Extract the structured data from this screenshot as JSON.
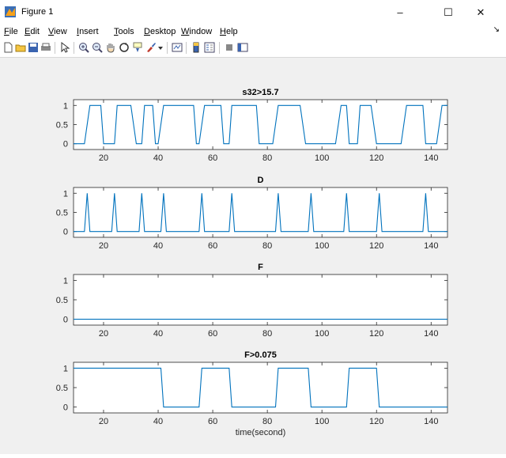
{
  "window": {
    "title": "Figure 1"
  },
  "window_controls": {
    "minimize": "–",
    "maximize": "☐",
    "close": "✕"
  },
  "menu": {
    "items": [
      {
        "label": "File",
        "key": "F",
        "rest": "ile"
      },
      {
        "label": "Edit",
        "key": "E",
        "rest": "dit"
      },
      {
        "label": "View",
        "key": "V",
        "rest": "iew"
      },
      {
        "label": "Insert",
        "key": "I",
        "rest": "nsert"
      },
      {
        "label": "Tools",
        "key": "T",
        "rest": "ools"
      },
      {
        "label": "Desktop",
        "key": "D",
        "rest": "esktop"
      },
      {
        "label": "Window",
        "key": "W",
        "rest": "indow"
      },
      {
        "label": "Help",
        "key": "H",
        "rest": "elp"
      }
    ]
  },
  "toolbar": {
    "icons": [
      "new-file-icon",
      "open-folder-icon",
      "save-icon",
      "print-icon",
      "pointer-icon",
      "zoom-in-icon",
      "zoom-out-icon",
      "pan-hand-icon",
      "rotate-3d-icon",
      "data-cursor-icon",
      "brush-icon",
      "dropdown-arrow-icon",
      "link-plot-icon",
      "colorbar-icon",
      "legend-icon",
      "hide-plot-tools-icon",
      "show-plot-tools-icon"
    ]
  },
  "colors": {
    "line": "#0072bd",
    "axes_bg": "#ffffff",
    "figure_bg": "#f0f0f0",
    "axis": "#262626"
  },
  "chart_data": [
    {
      "type": "line",
      "title": "s32>15.7",
      "xlabel": "",
      "ylabel": "",
      "xlim": [
        9,
        146
      ],
      "ylim": [
        -0.15,
        1.15
      ],
      "xticks": [
        20,
        40,
        60,
        80,
        100,
        120,
        140
      ],
      "yticks": [
        0,
        0.5,
        1
      ],
      "ytick_labels": [
        "0",
        "0.5",
        "1"
      ],
      "x": [
        9,
        13,
        15,
        19,
        20,
        24,
        25,
        30,
        32,
        34,
        35,
        38,
        39,
        40,
        42,
        53,
        54,
        55,
        57,
        63,
        64,
        66,
        67,
        76,
        77,
        82,
        84,
        92,
        94,
        105,
        107,
        109,
        110,
        113,
        114,
        118,
        120,
        129,
        131,
        137,
        138,
        142,
        144,
        146
      ],
      "y": [
        0,
        0,
        1,
        1,
        0,
        0,
        1,
        1,
        0,
        0,
        1,
        1,
        0,
        0,
        1,
        1,
        0,
        0,
        1,
        1,
        0,
        0,
        1,
        1,
        0,
        0,
        1,
        1,
        0,
        0,
        1,
        1,
        0,
        0,
        1,
        1,
        0,
        0,
        1,
        1,
        0,
        0,
        1,
        1
      ]
    },
    {
      "type": "line",
      "title": "D",
      "xlabel": "",
      "ylabel": "",
      "xlim": [
        9,
        146
      ],
      "ylim": [
        -0.15,
        1.15
      ],
      "xticks": [
        20,
        40,
        60,
        80,
        100,
        120,
        140
      ],
      "yticks": [
        0,
        0.5,
        1
      ],
      "ytick_labels": [
        "0",
        "0.5",
        "1"
      ],
      "x": [
        9,
        13,
        14,
        15,
        23,
        24,
        25,
        33,
        34,
        35,
        41,
        42,
        43,
        55,
        56,
        57,
        66,
        67,
        68,
        83,
        84,
        85,
        95,
        96,
        97,
        108,
        109,
        110,
        120,
        121,
        122,
        137,
        138,
        139,
        146
      ],
      "y": [
        0,
        0,
        1,
        0,
        0,
        1,
        0,
        0,
        1,
        0,
        0,
        1,
        0,
        0,
        1,
        0,
        0,
        1,
        0,
        0,
        1,
        0,
        0,
        1,
        0,
        0,
        1,
        0,
        0,
        1,
        0,
        0,
        1,
        0,
        0
      ]
    },
    {
      "type": "line",
      "title": "F",
      "xlabel": "",
      "ylabel": "",
      "xlim": [
        9,
        146
      ],
      "ylim": [
        -0.15,
        1.15
      ],
      "xticks": [
        20,
        40,
        60,
        80,
        100,
        120,
        140
      ],
      "yticks": [
        0,
        0.5,
        1
      ],
      "ytick_labels": [
        "0",
        "0.5",
        "1"
      ],
      "x": [
        9,
        146
      ],
      "y": [
        0,
        0
      ]
    },
    {
      "type": "line",
      "title": "F>0.075",
      "xlabel": "time(second)",
      "ylabel": "",
      "xlim": [
        9,
        146
      ],
      "ylim": [
        -0.15,
        1.15
      ],
      "xticks": [
        20,
        40,
        60,
        80,
        100,
        120,
        140
      ],
      "yticks": [
        0,
        0.5,
        1
      ],
      "ytick_labels": [
        "0",
        "0.5",
        "1"
      ],
      "x": [
        9,
        41,
        42,
        55,
        56,
        66,
        67,
        83,
        84,
        95,
        96,
        109,
        110,
        120,
        121,
        146
      ],
      "y": [
        1,
        1,
        0,
        0,
        1,
        1,
        0,
        0,
        1,
        1,
        0,
        0,
        1,
        1,
        0,
        0
      ]
    }
  ]
}
